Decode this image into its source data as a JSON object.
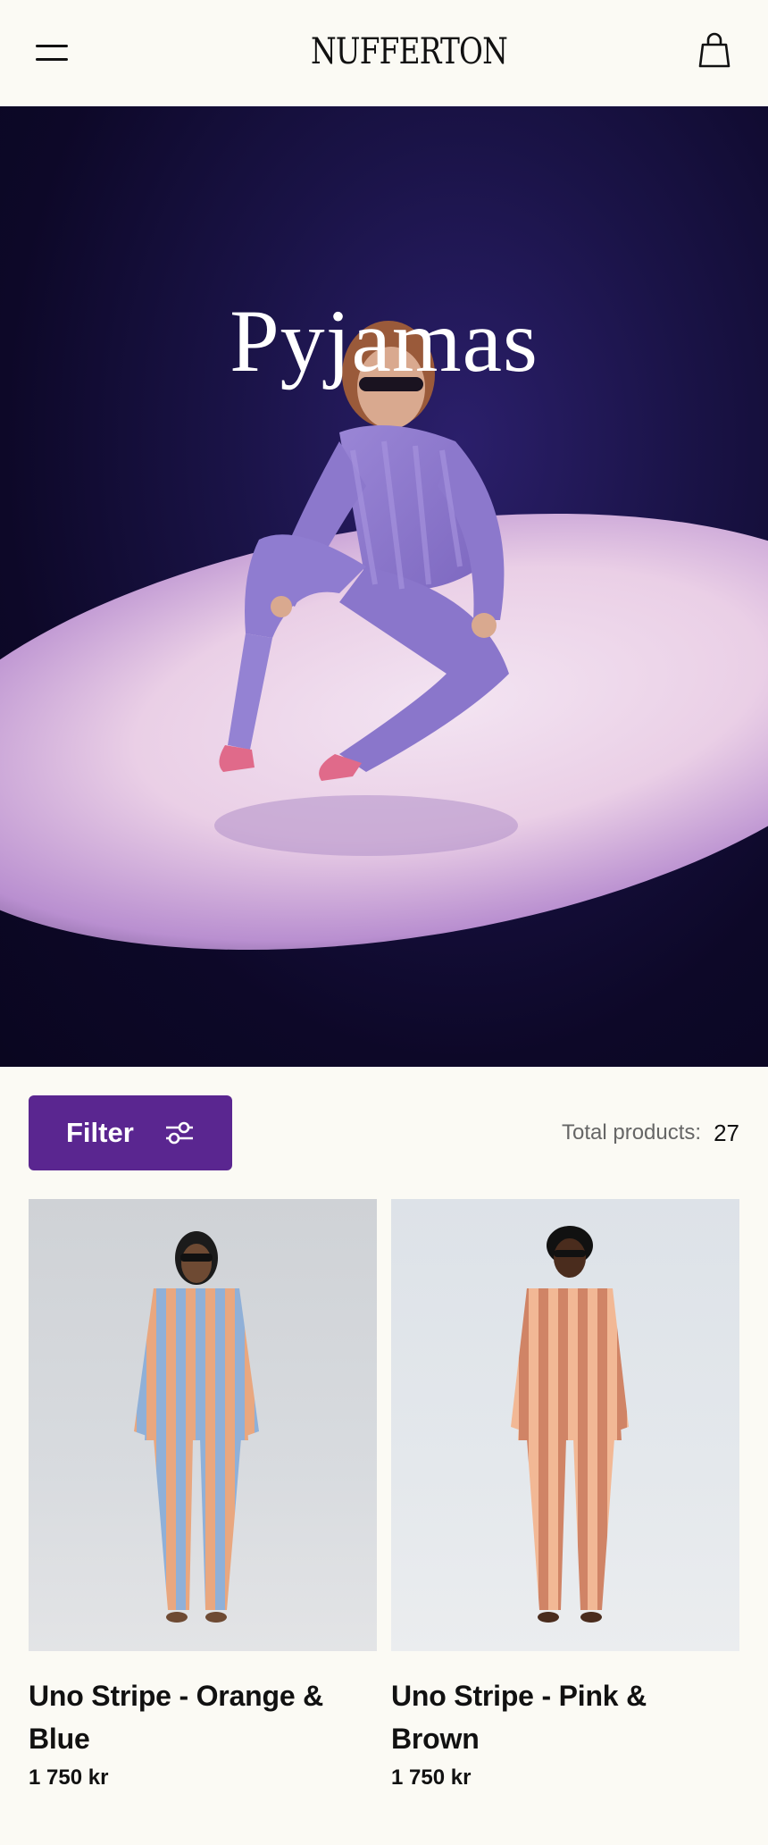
{
  "header": {
    "brand": "NUFFERTON",
    "menu_icon": "hamburger-menu-icon",
    "cart_icon": "shopping-bag-icon"
  },
  "hero": {
    "title": "Pyjamas"
  },
  "toolbar": {
    "filter_label": "Filter",
    "filter_icon": "sliders-icon",
    "total_label": "Total products:",
    "total_count": "27"
  },
  "products": [
    {
      "name": "Uno Stripe - Orange & Blue",
      "price": "1 750 kr",
      "stripe_a": "#e9a77f",
      "stripe_b": "#8fb0d8"
    },
    {
      "name": "Uno Stripe - Pink & Brown",
      "price": "1 750 kr",
      "stripe_a": "#f2b895",
      "stripe_b": "#d08466"
    }
  ],
  "colors": {
    "background": "#fbfaf4",
    "accent": "#5a2690",
    "text": "#111111"
  }
}
